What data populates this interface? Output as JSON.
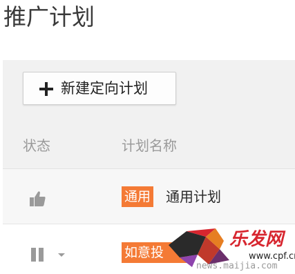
{
  "page": {
    "title": "推广计划"
  },
  "toolbar": {
    "new_plan_label": "新建定向计划"
  },
  "table": {
    "columns": [
      "状态",
      "计划名称"
    ],
    "rows": [
      {
        "status_icon": "thumbs-up-icon",
        "tag": "通用",
        "name": "通用计划"
      },
      {
        "status_icon": "pause-icon",
        "tag": "如意投",
        "name": ""
      }
    ]
  },
  "watermark": {
    "logo_text": "乐发网",
    "domain": "www.cpf.cn",
    "url": "news.maijia.com"
  },
  "colors": {
    "tag": "#f47a35",
    "panel": "#f1f1f1",
    "watermark_red": "#d7262f"
  }
}
